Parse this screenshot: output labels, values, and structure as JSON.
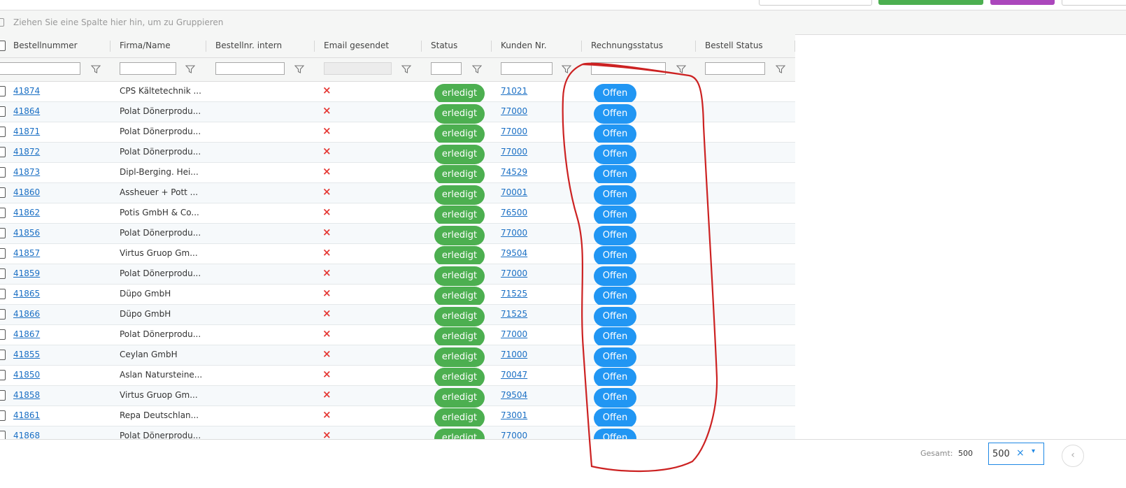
{
  "group_panel": {
    "hint": "Ziehen Sie eine Spalte hier hin, um zu Gruppieren"
  },
  "columns": {
    "bestellnummer": "Bestellnummer",
    "firma": "Firma/Name",
    "intern": "Bestellnr. intern",
    "email": "Email gesendet",
    "status": "Status",
    "kunden": "Kunden Nr.",
    "rechnung": "Rechnungsstatus",
    "bestell": "Bestell Status"
  },
  "status_labels": {
    "status": "erledigt",
    "rechnung": "Offen",
    "email_not_sent": "×"
  },
  "colors": {
    "status_green": "#4caf50",
    "invoice_blue": "#2196f3",
    "link": "#1a6fc4",
    "cross": "#e53935",
    "annotation": "#cc2222"
  },
  "rows": [
    {
      "nr": "41874",
      "firma": "CPS Kältetechnik ...",
      "kunde": "71021"
    },
    {
      "nr": "41864",
      "firma": "Polat Dönerprodu...",
      "kunde": "77000"
    },
    {
      "nr": "41871",
      "firma": "Polat Dönerprodu...",
      "kunde": "77000"
    },
    {
      "nr": "41872",
      "firma": "Polat Dönerprodu...",
      "kunde": "77000"
    },
    {
      "nr": "41873",
      "firma": "Dipl-Berging. Hei...",
      "kunde": "74529"
    },
    {
      "nr": "41860",
      "firma": "Assheuer + Pott ...",
      "kunde": "70001"
    },
    {
      "nr": "41862",
      "firma": "Potis GmbH & Co...",
      "kunde": "76500"
    },
    {
      "nr": "41856",
      "firma": "Polat Dönerprodu...",
      "kunde": "77000"
    },
    {
      "nr": "41857",
      "firma": "Virtus Gruop Gm...",
      "kunde": "79504"
    },
    {
      "nr": "41859",
      "firma": "Polat Dönerprodu...",
      "kunde": "77000"
    },
    {
      "nr": "41865",
      "firma": "Düpo GmbH",
      "kunde": "71525"
    },
    {
      "nr": "41866",
      "firma": "Düpo GmbH",
      "kunde": "71525"
    },
    {
      "nr": "41867",
      "firma": "Polat Dönerprodu...",
      "kunde": "77000"
    },
    {
      "nr": "41855",
      "firma": "Ceylan GmbH",
      "kunde": "71000"
    },
    {
      "nr": "41850",
      "firma": "Aslan Natursteine...",
      "kunde": "70047"
    },
    {
      "nr": "41858",
      "firma": "Virtus Gruop Gm...",
      "kunde": "79504"
    },
    {
      "nr": "41861",
      "firma": "Repa Deutschlan...",
      "kunde": "73001"
    },
    {
      "nr": "41868",
      "firma": "Polat Dönerprodu...",
      "kunde": "77000"
    }
  ],
  "footer": {
    "total_label": "Gesamt:",
    "total_value": "500",
    "page_size": "500",
    "clear": "×",
    "dropdown": "▾",
    "prev": "‹"
  }
}
